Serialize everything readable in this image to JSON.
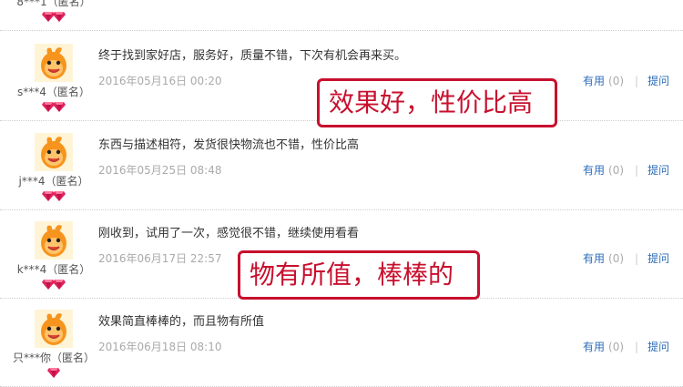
{
  "reviews": [
    {
      "user": "8***1（匿名）",
      "gems": 2,
      "content": "",
      "date": "",
      "useful_label": "",
      "useful_count": "",
      "ask_label": ""
    },
    {
      "user": "s***4（匿名）",
      "gems": 2,
      "content": "终于找到家好店，服务好，质量不错，下次有机会再来买。",
      "date": "2016年05月16日 00:20",
      "useful_label": "有用",
      "useful_count": "(0)",
      "ask_label": "提问"
    },
    {
      "user": "j***4（匿名）",
      "gems": 2,
      "content": "东西与描述相符，发货很快物流也不错，性价比高",
      "date": "2016年05月25日 08:48",
      "useful_label": "有用",
      "useful_count": "(0)",
      "ask_label": "提问"
    },
    {
      "user": "k***4（匿名）",
      "gems": 2,
      "content": "刚收到，试用了一次，感觉很不错，继续使用看看",
      "date": "2016年06月17日 22:57",
      "useful_label": "有用",
      "useful_count": "(0)",
      "ask_label": "提问"
    },
    {
      "user": "只***你（匿名）",
      "gems": 1,
      "content": "效果简直棒棒的，而且物有所值",
      "date": "2016年06月18日 08:10",
      "useful_label": "有用",
      "useful_count": "(0)",
      "ask_label": "提问"
    }
  ],
  "annotations": [
    "效果好，性价比高",
    "物有所值，棒棒的"
  ],
  "colors": {
    "link": "#2d6db8",
    "annotation": "#c8102e",
    "gem": "#e0245e",
    "avatar": "#f5a623"
  },
  "icons": {
    "avatar": "orange-mascot-avatar-icon",
    "gem": "heart-gem-icon"
  }
}
